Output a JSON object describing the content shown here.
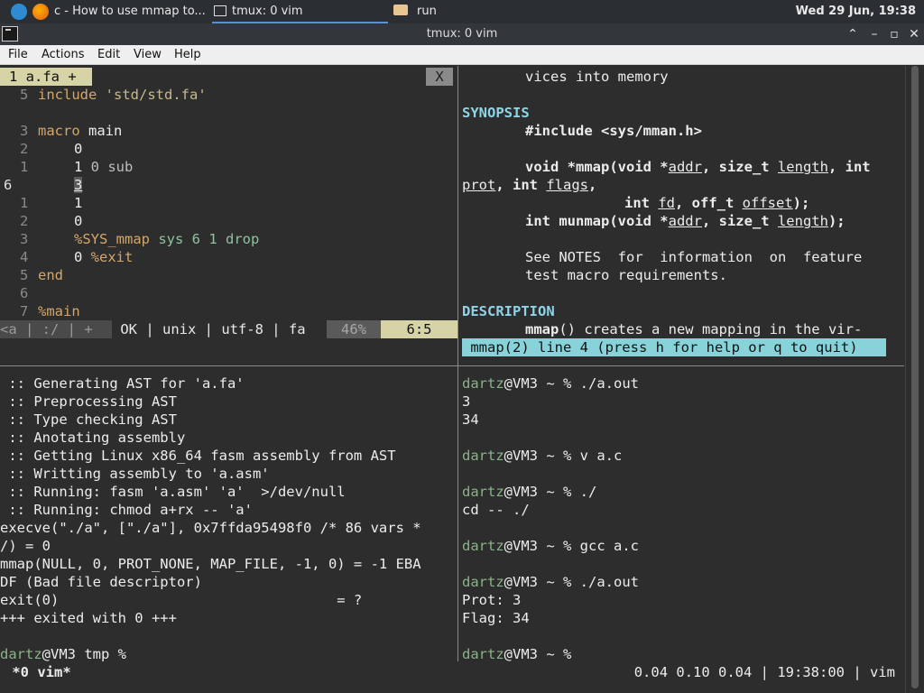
{
  "panel": {
    "tasks": [
      "c - How to use mmap to...",
      "tmux: 0 vim",
      "run"
    ],
    "clock": "Wed 29 Jun, 19:38"
  },
  "window": {
    "title": "tmux: 0 vim",
    "controls": [
      "⌃",
      "–",
      "▫",
      "✕"
    ]
  },
  "menu": [
    "File",
    "Actions",
    "Edit",
    "View",
    "Help"
  ],
  "vim": {
    "tab_label": "1 a.fa +",
    "tab_close": "X",
    "statusline": {
      "mode_seg": "<a | :/ | +",
      "info": " OK | unix | utf-8 | fa ",
      "percent": "46%",
      "position": "6:5"
    },
    "numbers": [
      "5",
      "",
      "3",
      "2",
      "1",
      "6",
      "1",
      "2",
      "3",
      "4",
      "5",
      "6",
      "7"
    ]
  },
  "man": {
    "status": " mmap(2) line 4 (press h for help or q to quit)"
  },
  "log_lines": [
    " :: Generating AST for 'a.fa'",
    " :: Preprocessing AST",
    " :: Type checking AST",
    " :: Anotating assembly",
    " :: Getting Linux x86_64 fasm assembly from AST",
    " :: Writting assembly to 'a.asm'",
    " :: Running: fasm 'a.asm' 'a'  >/dev/null",
    " :: Running: chmod a+rx -- 'a'",
    "execve(\"./a\", [\"./a\"], 0x7ffda95498f0 /* 86 vars *",
    "/) = 0",
    "mmap(NULL, 0, PROT_NONE, MAP_FILE, -1, 0) = -1 EBA",
    "DF (Bad file descriptor)",
    "exit(0)                                 = ?",
    "+++ exited with 0 +++",
    "",
    "dartz@VM3 tmp %"
  ],
  "shell": {
    "user": "dartz",
    "lines": [
      {
        "p": "@VM3 ~ % ./a.out"
      },
      {
        "t": "3"
      },
      {
        "t": "34"
      },
      {
        "t": ""
      },
      {
        "p": "@VM3 ~ % v a.c"
      },
      {
        "t": ""
      },
      {
        "p": "@VM3 ~ % ./"
      },
      {
        "t": "cd -- ./"
      },
      {
        "t": ""
      },
      {
        "p": "@VM3 ~ % gcc a.c"
      },
      {
        "t": ""
      },
      {
        "p": "@VM3 ~ % ./a.out"
      },
      {
        "t": "Prot: 3"
      },
      {
        "t": "Flag: 34"
      },
      {
        "t": ""
      },
      {
        "p": "@VM3 ~ %"
      }
    ]
  },
  "tmux": {
    "window": " *0 vim*",
    "status_right": "0.04 0.10 0.04 | 19:38:00 | vim"
  },
  "colors": {
    "tab_bg": "#d6d3a6",
    "status_bg": "#d6d3a6",
    "man_status_bg": "#87d3d9",
    "section": "#8fd4e6"
  }
}
